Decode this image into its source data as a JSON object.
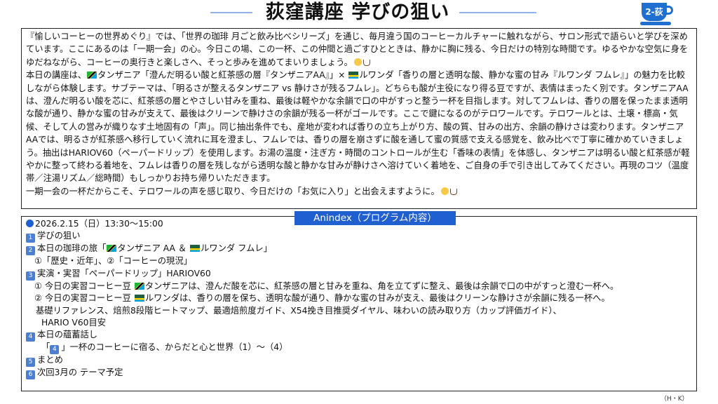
{
  "page_title": "荻窪講座 学びの狙い",
  "cup_badge": "2-荻",
  "intro": {
    "p1": "『愉しいコーヒーの世界めぐり』では、「世界の珈琲 月ごと飲み比べシリーズ」を通じ、毎月違う国のコーヒーカルチャーに触れながら、サロン形式で語らいと学びを深めています。ここにあるのは「一期一会」の心。今日この場、この一杯、この仲間と過ごすひとときは、静かに胸に残る、今日だけの特別な時間です。ゆるやかな空気に身をゆだねながら、コーヒーの奥行きと楽しさへ、そっと歩みを進めてまいりましょう。",
    "p2a": "本日の講座は、",
    "p2b": "タンザニア「澄んだ明るい酸と紅茶感の層『タンザニアAA』」× ",
    "p2c": "ルワンダ「香りの層と透明な酸、静かな蜜の甘み『ルワンダ フムレ』」の魅力を比較しながら体験します。サブテーマは、「明るさが整えるタンザニア vs 静けさが残るフムレ」。どちらも酸が主役になり得る豆ですが、表情はまったく別です。タンザニアAAは、澄んだ明るい酸を芯に、紅茶感の層とやさしい甘みを重ね、最後は軽やかな余韻で口の中がすっと整う一杯を目指します。対してフムレは、香りの層を保ったまま透明な酸が通り、静かな蜜の甘みが支えて、最後はクリーンで静けさの余韻が残る一杯がゴールです。ここで鍵になるのがテロワールです。テロワールとは、土壌・標高・気候、そして人の営みが織りなす土地固有の「声」。同じ抽出条件でも、産地が変われば香りの立ち上がり方、酸の質、甘みの出方、余韻の静けさは変わります。タンザニアAAでは、明るさが紅茶感へ移行していく流れに耳を澄まし、フムレでは、香りの層を崩さずに酸を通して蜜の質感で支える感覚を、飲み比べで丁寧に確かめていきましょう。抽出はHARIOV60（ペーパードリップ）を使用します。お湯の温度・注ぎ方・時間のコントロールが生む「香味の表情」を体感し、タンザニアは明るい酸と紅茶感が軽やかに整って終わる着地を、フムレは香りの層を残しながら透明な酸と静かな甘みが静けさへ溶けていく着地を、ご自身の手で引き出してみてください。再現のコツ（温度帯／注湯リズム／総時間）もしっかりお持ち帰りいただきます。",
    "p3": "一期一会の一杯だからこそ、テロワールの声を感じ取り、今日だけの「お気に入り」と出会えますように。"
  },
  "program": {
    "header": "Anindex（プログラム内容）",
    "date": "2026.2.15（日）13:30〜15:00",
    "items": [
      {
        "num": "1",
        "text": "学びの狙い"
      },
      {
        "num": "2",
        "text_a": "本日の珈琲の旅「",
        "text_b": "タンザニア AA ＆ ",
        "text_c": "ルワンダ フムレ」"
      },
      {
        "num": "3",
        "text": "実演・実習「ペーパードリップ」HARIOV60"
      },
      {
        "num": "4",
        "text": "本日の蘊蓄話し"
      },
      {
        "num": "5",
        "text": "まとめ"
      },
      {
        "num": "6",
        "text": "次回3月の テーマ予定"
      }
    ],
    "item2_sub": "①「歴史・近年」、②「コーヒーの現況」",
    "item3_sub1a": "① 今日の実習コーヒー豆 ",
    "item3_sub1b": "タンザニアは、澄んだ酸を芯に、紅茶感の層と甘みを重ね、角を立てずに整え、最後は余韻で口の中がすっと澄む一杯へ。",
    "item3_sub2a": "② 今日の実習コーヒー豆 ",
    "item3_sub2b": "ルワンダは、香りの層を保ち、透明な酸が通り、静かな蜜の甘みが支え、最後はクリーンな静けさが余韻に残る一杯へ。",
    "item3_sub3": "基礎リファレンス、焙煎8段階ヒートマップ、最適焙煎度ガイド、X54挽き目推奨ダイヤル、味わいの読み取り方（カップ評価ガイド）、",
    "item3_sub4": "HARIO V60目安",
    "item4_sub_a": "「",
    "item4_sub_b": "」一杯のコーヒーに宿る、からだと心と世界（1）〜（4）"
  },
  "credit": "（H・K）",
  "colors": {
    "accent": "#1f5fcf",
    "num_badge": "#4a7fd4",
    "title_line": "#8fb3e8"
  }
}
